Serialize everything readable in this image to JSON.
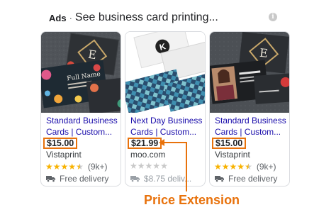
{
  "header": {
    "ads_label": "Ads",
    "separator": "·",
    "title": "See business card printing...",
    "info_icon_glyph": "i"
  },
  "cards": [
    {
      "title_line1": "Standard Business",
      "title_line2": "Cards | Custom...",
      "price": "$15.00",
      "store": "Vistaprint",
      "rating": 4.5,
      "review_count": "(9k+)",
      "delivery": "Free delivery",
      "image": {
        "name_text": "Full Name",
        "monogram": "E"
      }
    },
    {
      "title_line1": "Next Day Business",
      "title_line2": "Cards | Custom...",
      "price": "$21.99",
      "store": "moo.com",
      "rating": 0,
      "review_count": "",
      "delivery": "$8.75 deliv...",
      "image": {
        "monogram": "K"
      }
    },
    {
      "title_line1": "Standard Business",
      "title_line2": "Cards | Custom...",
      "price": "$15.00",
      "store": "Vistaprint",
      "rating": 4.5,
      "review_count": "(9k+)",
      "delivery": "Free delivery",
      "image": {
        "monogram": "E"
      }
    }
  ],
  "callout": {
    "label": "Price Extension",
    "color": "#e8720c"
  },
  "colors": {
    "link": "#1a0dab",
    "star": "#f8b200",
    "highlight": "#e8720c"
  }
}
